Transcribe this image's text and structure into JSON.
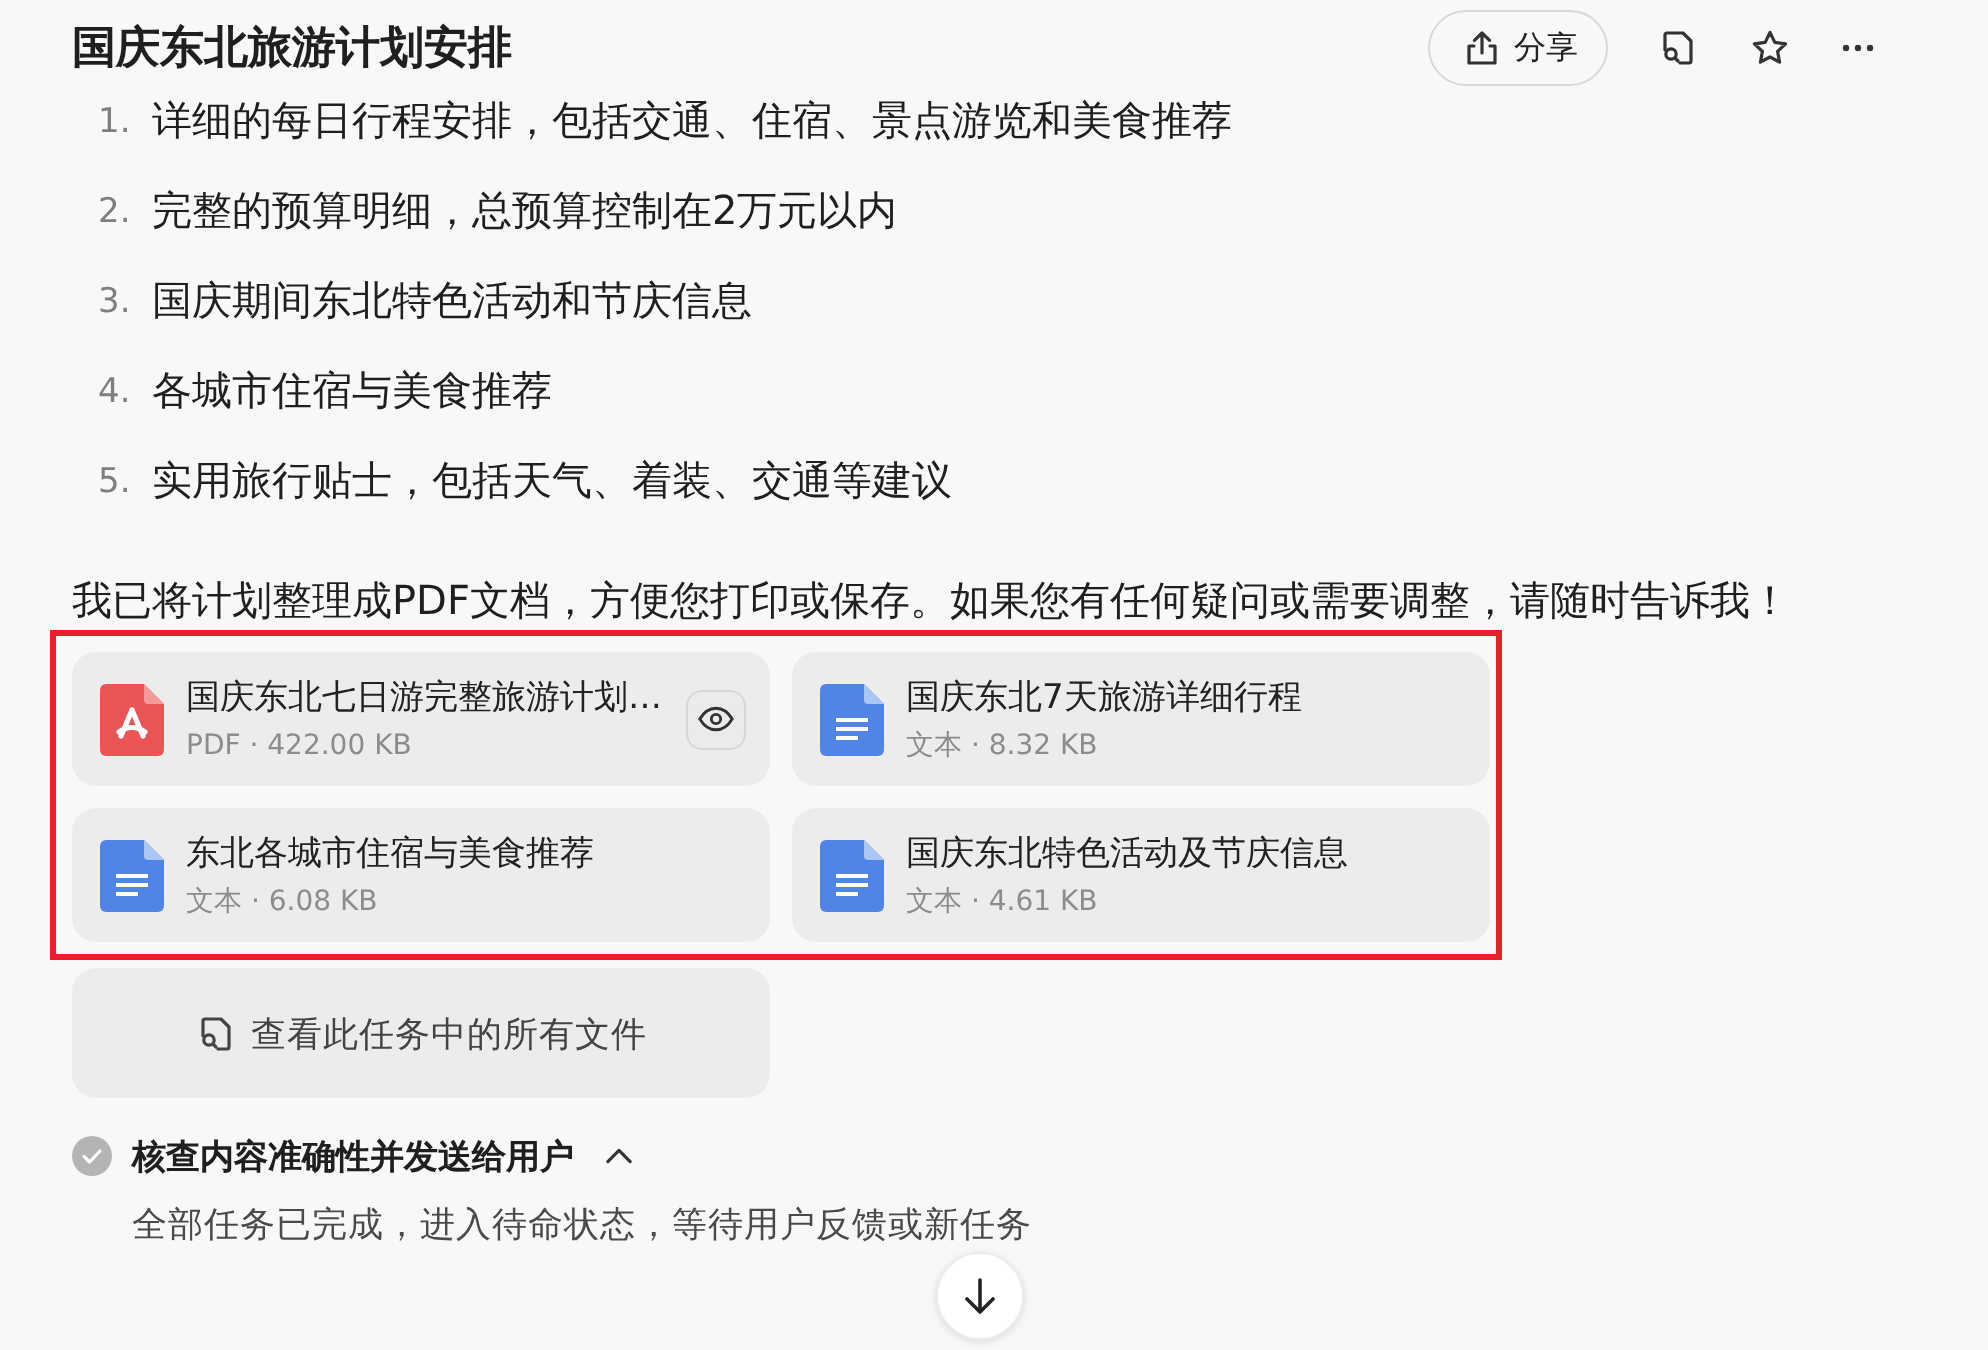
{
  "header": {
    "title": "国庆东北旅游计划安排",
    "share_button": "分享"
  },
  "list": [
    {
      "number": "1.",
      "text": "详细的每日行程安排，包括交通、住宿、景点游览和美食推荐"
    },
    {
      "number": "2.",
      "text": "完整的预算明细，总预算控制在2万元以内"
    },
    {
      "number": "3.",
      "text": "国庆期间东北特色活动和节庆信息"
    },
    {
      "number": "4.",
      "text": "各城市住宿与美食推荐"
    },
    {
      "number": "5.",
      "text": "实用旅行贴士，包括天气、着装、交通等建议"
    }
  ],
  "message": "我已将计划整理成PDF文档，方便您打印或保存。如果您有任何疑问或需要调整，请随时告诉我！",
  "files": {
    "highlighted": true,
    "items": [
      {
        "kind": "pdf",
        "name": "国庆东北七日游完整旅游计划…",
        "meta": "PDF · 422.00 KB",
        "preview": true
      },
      {
        "kind": "text",
        "name": "国庆东北7天旅游详细行程",
        "meta": "文本 · 8.32 KB",
        "preview": false
      },
      {
        "kind": "text",
        "name": "东北各城市住宿与美食推荐",
        "meta": "文本 · 6.08 KB",
        "preview": false
      },
      {
        "kind": "text",
        "name": "国庆东北特色活动及节庆信息",
        "meta": "文本 · 4.61 KB",
        "preview": false
      }
    ]
  },
  "view_all_button": "查看此任务中的所有文件",
  "step": {
    "done": true,
    "title": "核查内容准确性并发送给用户",
    "expanded": true,
    "description": "全部任务已完成，进入待命状态，等待用户反馈或新任务"
  }
}
